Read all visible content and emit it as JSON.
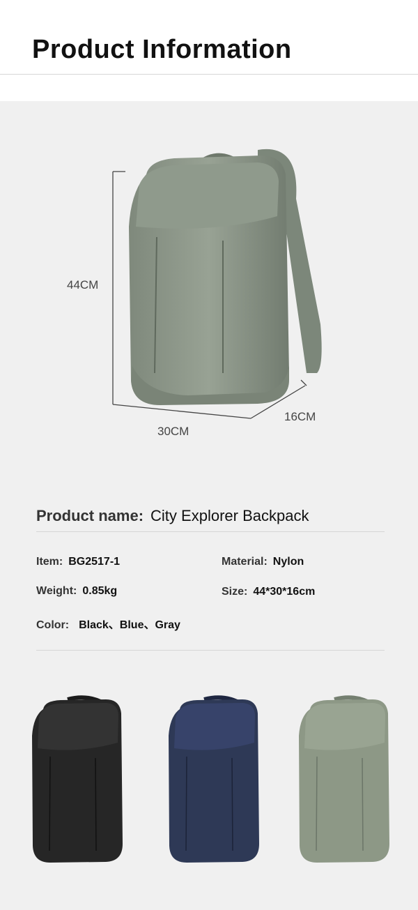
{
  "header": {
    "title": "Product Information"
  },
  "dimensions": {
    "height": "44CM",
    "width": "30CM",
    "depth": "16CM"
  },
  "product": {
    "name_label": "Product name:",
    "name_value": "City Explorer Backpack",
    "item_label": "Item:",
    "item_value": "BG2517-1",
    "material_label": "Material:",
    "material_value": "Nylon",
    "weight_label": "Weight:",
    "weight_value": "0.85kg",
    "size_label": "Size:",
    "size_value": "44*30*16cm",
    "color_label": "Color:",
    "color_value": "Black、Blue、Gray"
  },
  "colors": {
    "green": "#8a9487",
    "black": "#262626",
    "blue": "#2e3956",
    "gray": "#8d9886"
  },
  "variants": [
    {
      "name": "black-backpack-image"
    },
    {
      "name": "blue-backpack-image"
    },
    {
      "name": "gray-backpack-image"
    }
  ]
}
